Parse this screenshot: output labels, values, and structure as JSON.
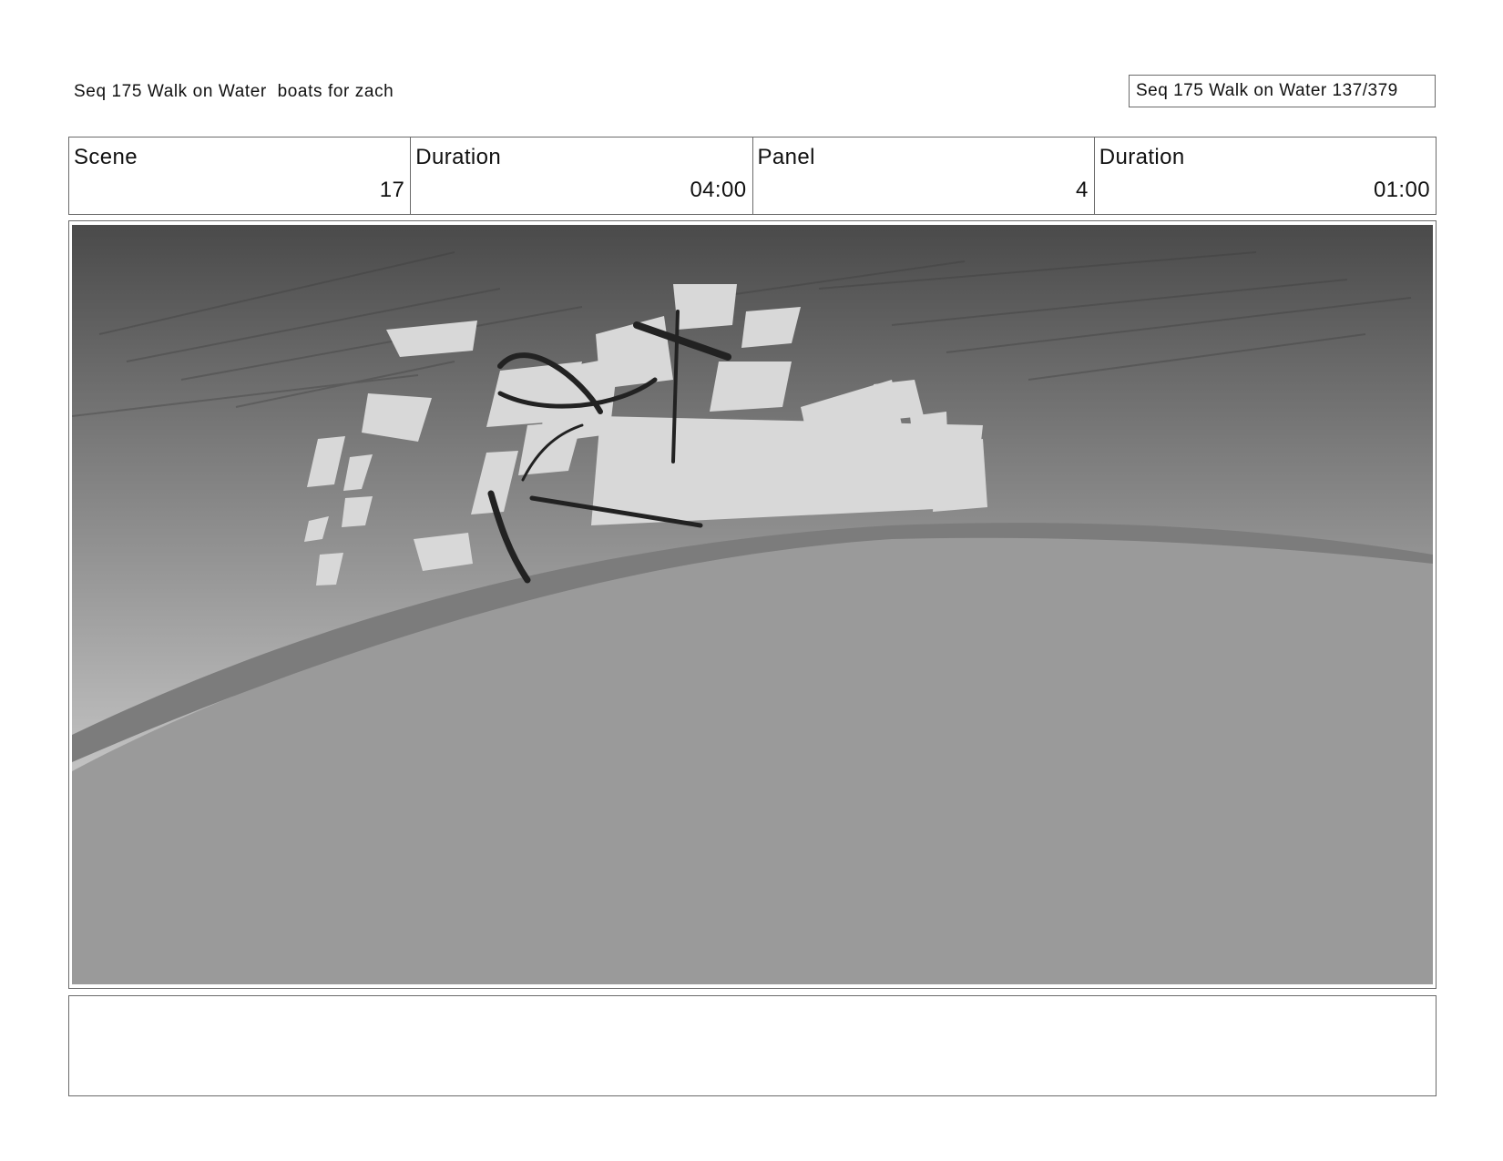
{
  "header": {
    "title": "Seq 175 Walk on Water  boats for zach",
    "page_counter": "Seq 175 Walk on Water 137/379"
  },
  "info": {
    "scene_label": "Scene",
    "scene_value": "17",
    "scene_duration_label": "Duration",
    "scene_duration_value": "04:00",
    "panel_label": "Panel",
    "panel_value": "4",
    "panel_duration_label": "Duration",
    "panel_duration_value": "01:00"
  },
  "panel": {
    "description": "",
    "colors": {
      "sky_top": "#4a4a4a",
      "sky_bottom": "#c8c8c8",
      "ground": "#9a9a9a",
      "ridge": "#7c7c7c",
      "splash": "#d8d8d8",
      "ink": "#222222"
    }
  },
  "notes": {
    "text": ""
  }
}
